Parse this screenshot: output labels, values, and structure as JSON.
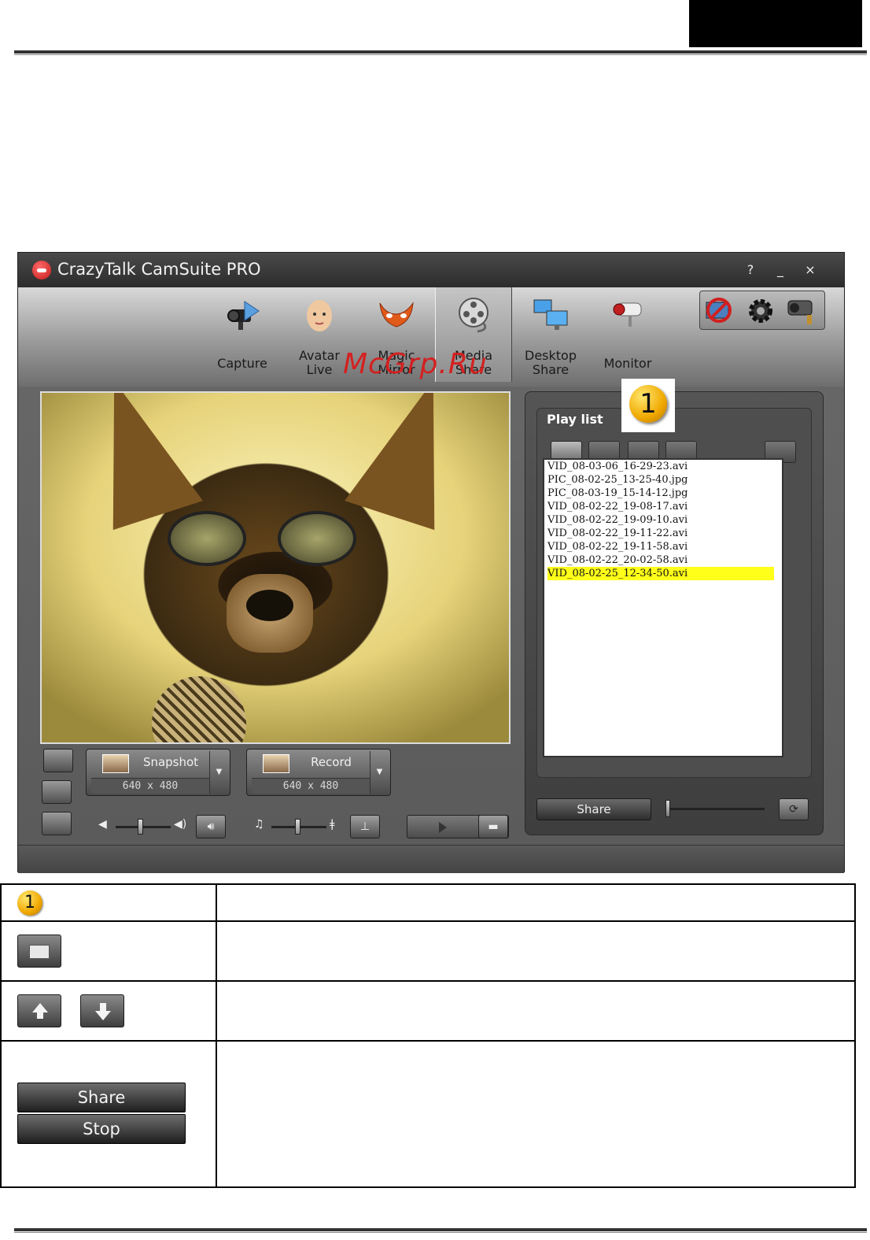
{
  "window": {
    "app_title": "CrazyTalk CamSuite PRO",
    "controls": {
      "help": "?",
      "minimize": "_",
      "close": "×"
    }
  },
  "tabs": [
    {
      "label": "Capture",
      "icon": "camera-icon"
    },
    {
      "label": "Avatar\nLive",
      "icon": "baby-face-icon"
    },
    {
      "label": "Magic\nMirror",
      "icon": "mask-icon"
    },
    {
      "label": "Media\nShare",
      "icon": "film-reel-icon",
      "active": true
    },
    {
      "label": "Desktop\nShare",
      "icon": "monitors-icon"
    },
    {
      "label": "Monitor",
      "icon": "security-camera-icon"
    }
  ],
  "toolbar_right": [
    "cam-off-icon",
    "gear-icon",
    "webcam-icon"
  ],
  "watermark": "McGrp.Ru",
  "capture": {
    "snapshot": {
      "label": "Snapshot",
      "resolution": "640 x 480"
    },
    "record": {
      "label": "Record",
      "resolution": "640 x 480"
    }
  },
  "playlist": {
    "title": "Play list",
    "items": [
      "VID_08-03-06_16-29-23.avi",
      "PIC_08-02-25_13-25-40.jpg",
      "PIC_08-03-19_15-14-12.jpg",
      "VID_08-02-22_19-08-17.avi",
      "VID_08-02-22_19-09-10.avi",
      "VID_08-02-22_19-11-22.avi",
      "VID_08-02-22_19-11-58.avi",
      "VID_08-02-22_20-02-58.avi",
      "VID_08-02-25_12-34-50.avi"
    ],
    "selected_index": 8,
    "share_label": "Share"
  },
  "callout_number": "1",
  "legend": {
    "badge": "1",
    "share_label": "Share",
    "stop_label": "Stop"
  },
  "colors": {
    "selection": "#ffff1a",
    "watermark": "#d42020",
    "badge": "#f0a800"
  }
}
